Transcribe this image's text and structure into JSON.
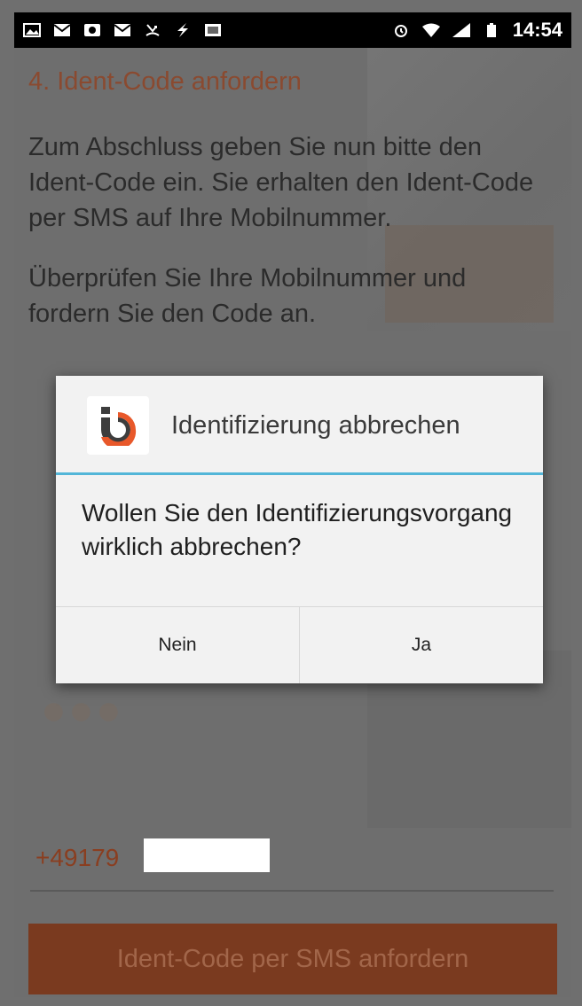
{
  "status_bar": {
    "left_icons": [
      "image-icon",
      "mail-icon",
      "photo-icon",
      "mail-icon",
      "missed-call-icon",
      "flash-icon",
      "gallery-icon"
    ],
    "right_icons": [
      "alarm-icon",
      "wifi-icon",
      "signal-icon",
      "battery-icon"
    ],
    "time": "14:54"
  },
  "screen": {
    "step_title": "4. Ident-Code anfordern",
    "intro_text": "Zum Abschluss geben Sie nun bitte den Ident-Code ein. Sie erhalten den Ident-Code per SMS auf Ihre Mobilnummer.",
    "intro_text_2": "Überprüfen Sie Ihre Mobilnummer und fordern Sie den Code an.",
    "phone_number_visible": "+49179",
    "sms_button_label": "Ident-Code per SMS anfordern"
  },
  "dialog": {
    "title": "Identifizierung abbrechen",
    "message": "Wollen Sie den Identifizierungsvorgang wirklich abbrechen?",
    "negative_label": "Nein",
    "positive_label": "Ja"
  },
  "colors": {
    "accent": "#53b6d8",
    "brand_orange": "#e8582a",
    "brand_dark": "#3d3d3d"
  }
}
